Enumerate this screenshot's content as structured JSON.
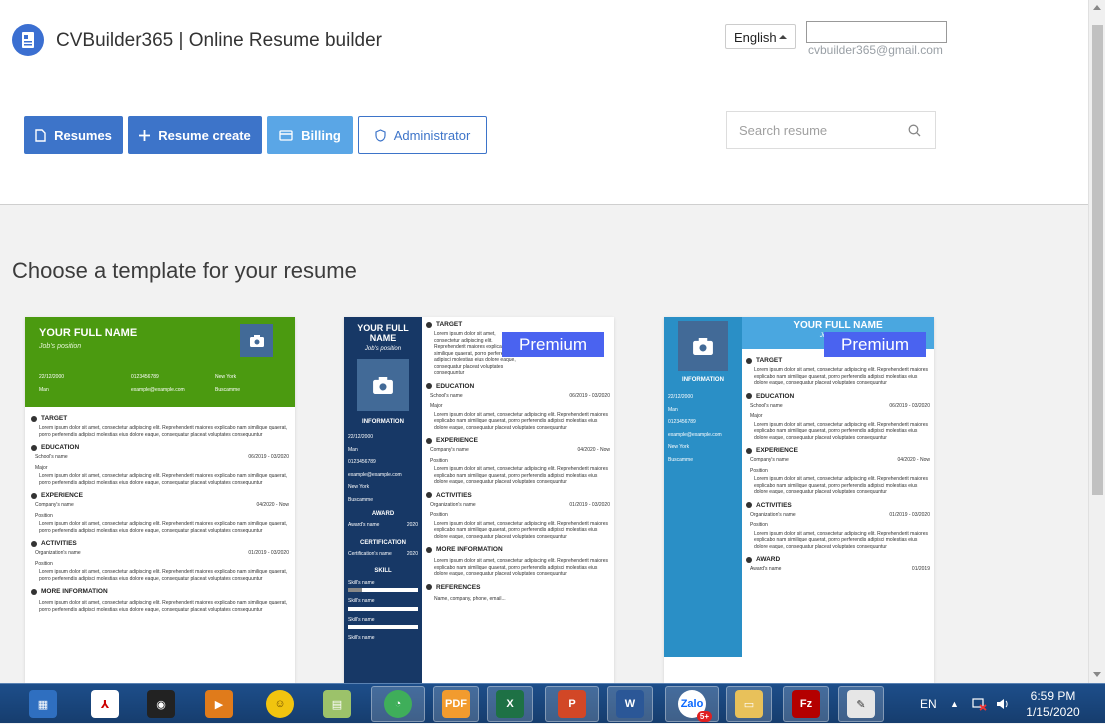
{
  "header": {
    "app_title": "CVBuilder365 | Online Resume builder",
    "language": "English",
    "account_value": "",
    "email": "cvbuilder365@gmail.com",
    "nav": {
      "resumes": "Resumes",
      "resume_create": "Resume create",
      "billing": "Billing",
      "administrator": "Administrator"
    },
    "search_placeholder": "Search resume"
  },
  "main": {
    "section_title": "Choose a template for your resume",
    "premium_label": "Premium",
    "template1": {
      "name": "YOUR FULL NAME",
      "position": "Job's position",
      "contacts": [
        "22/12/2000",
        "0123456789",
        "New York",
        "Man",
        "example@example.com",
        "Buscamme"
      ],
      "sections": {
        "target": "TARGET",
        "education": "EDUCATION",
        "experience": "EXPERIENCE",
        "activities": "ACTIVITIES",
        "more_info": "MORE INFORMATION"
      },
      "school": "School's name",
      "school_dates": "06/2019 - 03/2020",
      "major": "Major",
      "company": "Company's name",
      "company_dates": "04/2020 - Now",
      "position_label": "Position",
      "organization": "Organization's name",
      "org_dates": "01/2019 - 03/2020",
      "lorem1": "Lorem ipsum dolor sit amet, consectetur adipiscing elit. Reprehenderit maiores explicabo nam similique quaerat, porro perferendis adipisci molestias eius dolore eaque, consequatur placeat voluptates consequuntur",
      "lorem2": "Lorem ipsum dolor sit amet, consectetur adipiscing elit. Reprehenderit maiores explicabo nam similique quaerat, porro perferendis adipisci molestias eius dolore eaque, consequatur placeat voluptates consequuntur"
    },
    "template2": {
      "name": "YOUR FULL NAME",
      "position": "Job's position",
      "information": "INFORMATION",
      "contacts": [
        "22/12/2000",
        "Man",
        "0123456789",
        "example@example.com",
        "New York",
        "Buscamme"
      ],
      "award": "AWARD",
      "award_name": "Award's name",
      "award_year": "2020",
      "certification": "CERTIFICATION",
      "cert_name": "Certification's name",
      "cert_year": "2020",
      "skill": "SKILL",
      "skill_name": "Skill's name",
      "sections": {
        "target": "TARGET",
        "education": "EDUCATION",
        "experience": "EXPERIENCE",
        "activities": "ACTIVITIES",
        "more_info": "MORE INFORMATION",
        "references": "REFERENCES"
      },
      "school": "School's name",
      "school_dates": "06/2019 - 03/2020",
      "major": "Major",
      "company": "Company's name",
      "company_dates": "04/2020 - Now",
      "position_label": "Position",
      "organization": "Organization's name",
      "org_dates": "01/2019 - 03/2020",
      "references_text": "Name, company, phone, email...",
      "lorem": "Lorem ipsum dolor sit amet, consectetur adipiscing elit. Reprehenderit maiores explicabo nam similique quaerat, porro perferendis adipisci molestias eius dolore eaque, consequatur placeat voluptates consequuntur"
    },
    "template3": {
      "name": "YOUR FULL NAME",
      "position": "Job's position",
      "information": "INFORMATION",
      "contacts": [
        "22/12/2000",
        "Man",
        "0123456789",
        "example@example.com",
        "New York",
        "Buscamme"
      ],
      "sections": {
        "target": "TARGET",
        "education": "EDUCATION",
        "experience": "EXPERIENCE",
        "activities": "ACTIVITIES",
        "award": "AWARD"
      },
      "school": "School's name",
      "school_dates": "06/2019 - 03/2020",
      "major": "Major",
      "company": "Company's name",
      "company_dates": "04/2020 - Now",
      "position_label": "Position",
      "organization": "Organization's name",
      "org_dates": "01/2019 - 03/2020",
      "award_name": "Award's name",
      "award_date": "01/2019",
      "lorem": "Lorem ipsum dolor sit amet, consectetur adipiscing elit. Reprehenderit maiores explicabo nam similique quaerat, porro perferendis adipisci molestias eius dolore eaque, consequatur placeat voluptates consequuntur"
    }
  },
  "taskbar": {
    "apps": [
      "windows-explorer",
      "pdf-reader",
      "eye-app",
      "media-player",
      "smiley-app",
      "notes-app",
      "coccoc-browser",
      "pdf-tool",
      "excel",
      "powerpoint",
      "word",
      "zalo",
      "file-explorer",
      "filezilla",
      "notepad"
    ],
    "zalo_badge": "5+",
    "language": "EN",
    "time": "6:59 PM",
    "date": "1/15/2020"
  },
  "colors": {
    "primary": "#3d74c9",
    "billing": "#5aa6e6",
    "template1_green": "#4b9a10",
    "template2_navy": "#173866",
    "template3_blue": "#2a8fc6",
    "premium_badge": "#4a63f0"
  }
}
